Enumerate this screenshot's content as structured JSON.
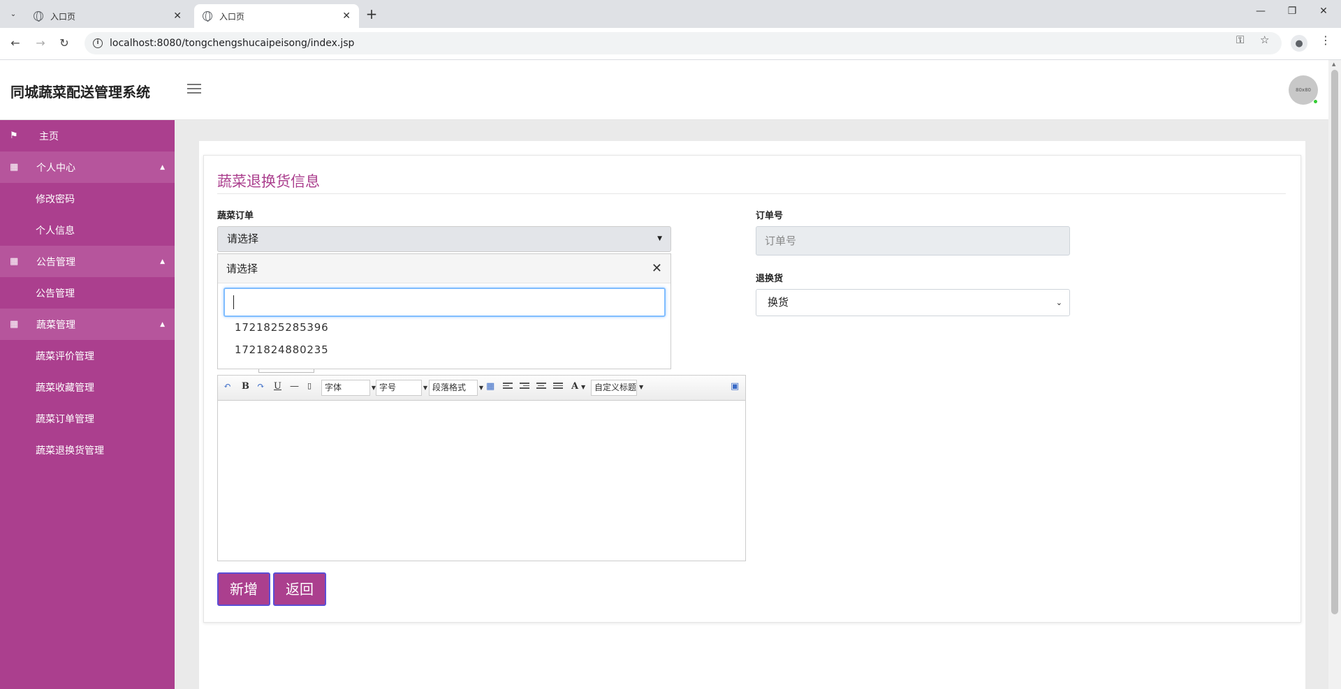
{
  "browser": {
    "tabs": [
      {
        "title": "入口页",
        "active": false
      },
      {
        "title": "入口页",
        "active": true
      }
    ],
    "url": "localhost:8080/tongchengshucaipeisong/index.jsp"
  },
  "header": {
    "app_title": "同城蔬菜配送管理系统",
    "avatar_text": "80x80"
  },
  "sidebar": {
    "home": "主页",
    "groups": [
      {
        "label": "个人中心",
        "items": [
          "修改密码",
          "个人信息"
        ]
      },
      {
        "label": "公告管理",
        "items": [
          "公告管理"
        ]
      },
      {
        "label": "蔬菜管理",
        "items": [
          "蔬菜评价管理",
          "蔬菜收藏管理",
          "蔬菜订单管理",
          "蔬菜退换货管理"
        ]
      }
    ]
  },
  "form": {
    "title": "蔬菜退换货信息",
    "order_label": "蔬菜订单",
    "order_value": "请选择",
    "dropdown": {
      "selected": "请选择",
      "search_value": "",
      "options": [
        "1721825285396",
        "1721824880235"
      ]
    },
    "order_no_label": "订单号",
    "order_no_placeholder": "订单号",
    "return_label": "退换货",
    "return_value": "换货",
    "editor_toolbar": {
      "font_family": "字体",
      "font_size": "字号",
      "paragraph": "段落格式",
      "custom_title": "自定义标题"
    },
    "submit_label": "新增",
    "back_label": "返回"
  }
}
